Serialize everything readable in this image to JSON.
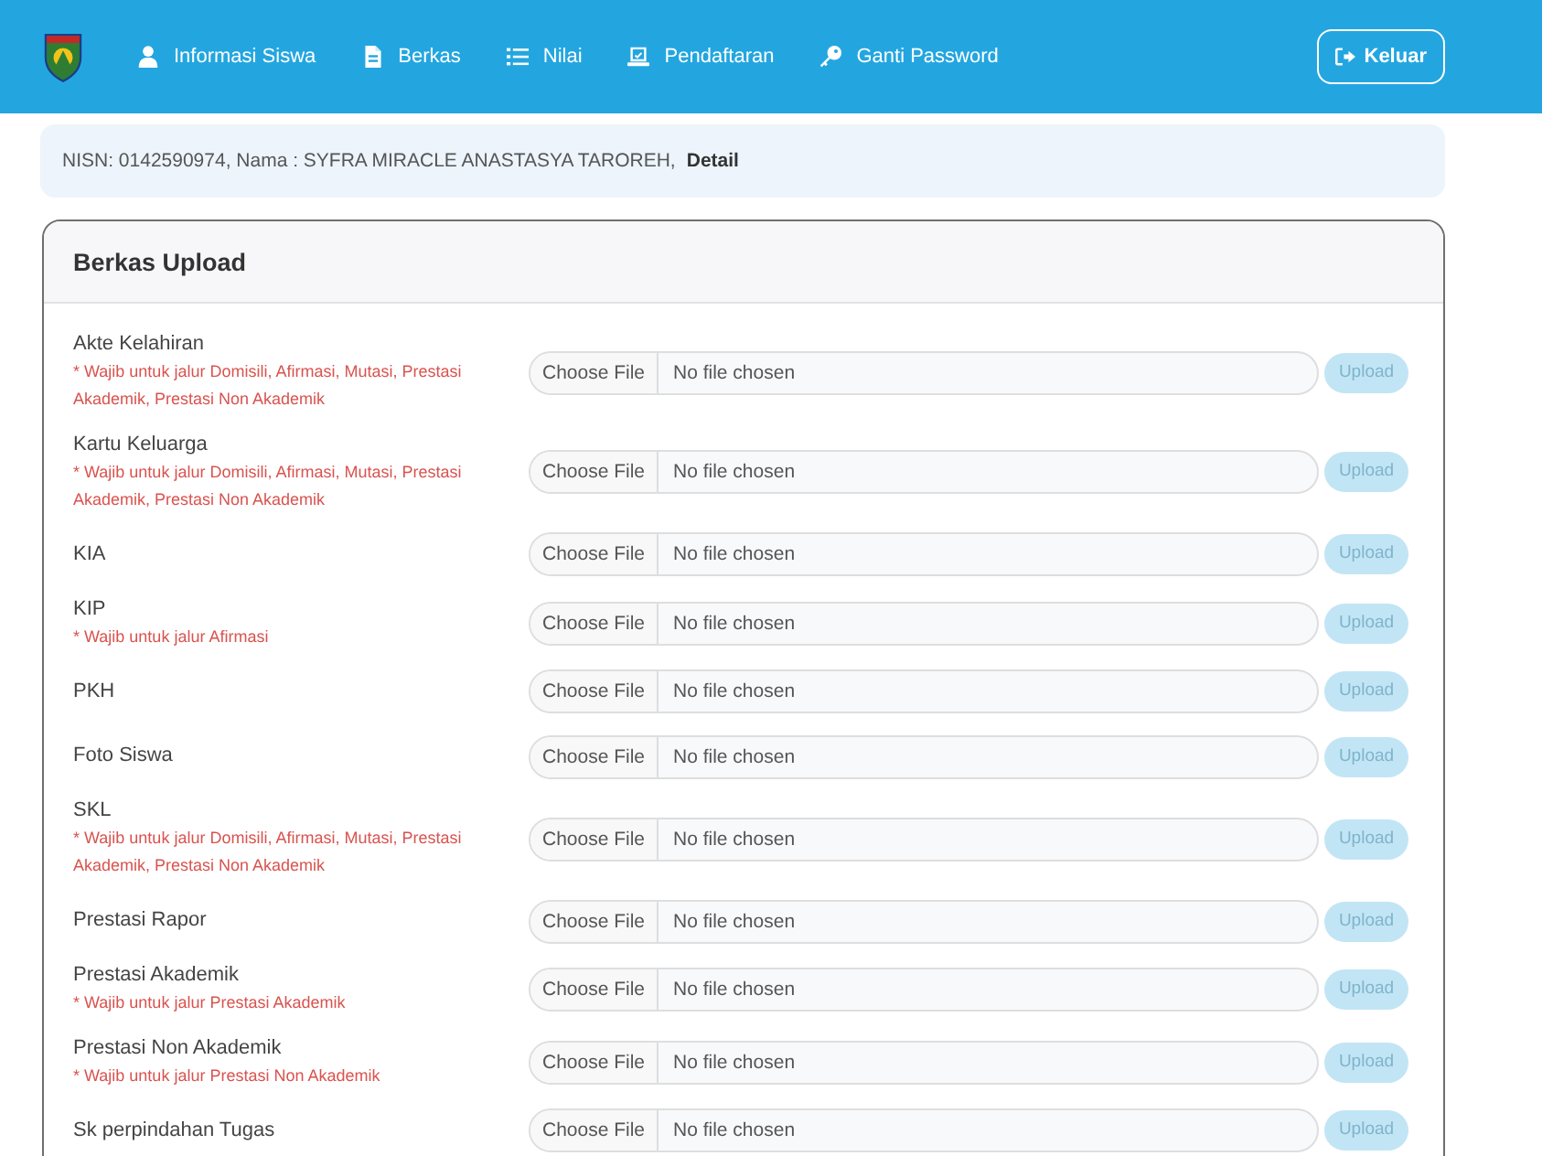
{
  "navbar": {
    "items": [
      {
        "label": "Informasi Siswa",
        "selected": false
      },
      {
        "label": "Berkas",
        "selected": false
      },
      {
        "label": "Nilai",
        "selected": false
      },
      {
        "label": "Pendaftaran",
        "selected": false
      },
      {
        "label": "Ganti Password",
        "selected": false
      }
    ],
    "logout": {
      "label": "Keluar"
    }
  },
  "student_bar": {
    "text": "NISN: 0142590974, Nama : SYFRA MIRACLE ANASTASYA TAROREH,",
    "link": "Detail"
  },
  "card": {
    "title": "Berkas Upload",
    "rows": [
      {
        "label": "Akte Kelahiran",
        "note": "* Wajib untuk jalur Domisili, Afirmasi, Mutasi, Prestasi Akademik, Prestasi Non Akademik",
        "choose_button": "Choose File",
        "file_status": "No file chosen",
        "upload": {
          "label": "Upload",
          "disabled": true
        }
      },
      {
        "label": "Kartu Keluarga",
        "note": "* Wajib untuk jalur Domisili, Afirmasi, Mutasi, Prestasi Akademik, Prestasi Non Akademik",
        "choose_button": "Choose File",
        "file_status": "No file chosen",
        "upload": {
          "label": "Upload",
          "disabled": true
        }
      },
      {
        "label": "KIA",
        "choose_button": "Choose File",
        "file_status": "No file chosen",
        "upload": {
          "label": "Upload",
          "disabled": true
        }
      },
      {
        "label": "KIP",
        "note": "* Wajib untuk jalur Afirmasi",
        "choose_button": "Choose File",
        "file_status": "No file chosen",
        "upload": {
          "label": "Upload",
          "disabled": true
        }
      },
      {
        "label": "PKH",
        "choose_button": "Choose File",
        "file_status": "No file chosen",
        "upload": {
          "label": "Upload",
          "disabled": true
        }
      },
      {
        "label": "Foto Siswa",
        "choose_button": "Choose File",
        "file_status": "No file chosen",
        "upload": {
          "label": "Upload",
          "disabled": true
        }
      },
      {
        "label": "SKL",
        "note": "* Wajib untuk jalur Domisili, Afirmasi, Mutasi, Prestasi Akademik, Prestasi Non Akademik",
        "choose_button": "Choose File",
        "file_status": "No file chosen",
        "upload": {
          "label": "Upload",
          "disabled": true
        }
      },
      {
        "label": "Prestasi Rapor",
        "choose_button": "Choose File",
        "file_status": "No file chosen",
        "upload": {
          "label": "Upload",
          "disabled": true
        }
      },
      {
        "label": "Prestasi Akademik",
        "note": "* Wajib untuk jalur Prestasi Akademik",
        "choose_button": "Choose File",
        "file_status": "No file chosen",
        "upload": {
          "label": "Upload",
          "disabled": true
        }
      },
      {
        "label": "Prestasi Non Akademik",
        "note": "* Wajib untuk jalur Prestasi Non Akademik",
        "choose_button": "Choose File",
        "file_status": "No file chosen",
        "upload": {
          "label": "Upload",
          "disabled": true
        }
      },
      {
        "label": "Sk perpindahan Tugas",
        "choose_button": "Choose File",
        "file_status": "No file chosen",
        "upload": {
          "label": "Upload",
          "disabled": true
        }
      }
    ]
  }
}
